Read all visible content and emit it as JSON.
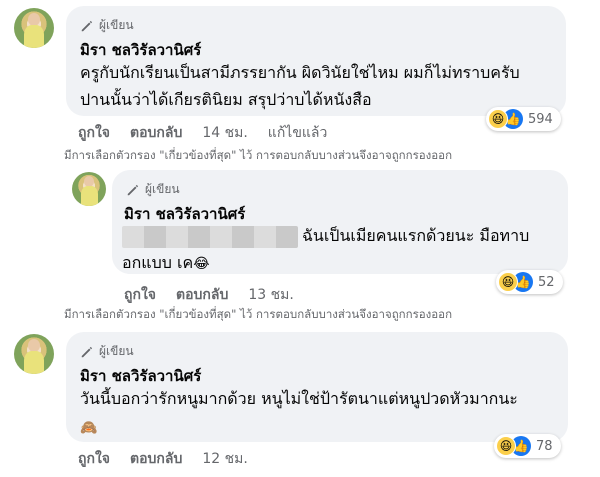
{
  "comments": [
    {
      "badge": "ผู้เขียน",
      "name": "มิรา ชลวิรัลวานิศร์",
      "lines": [
        "ครูกับนักเรียนเป็นสามีภรรยากัน ผิดวินัยใช่ไหม ผมก็ไม่ทราบครับ",
        "ปานนั้นว่าได้เกียรตินิยม สรุปว่าบได้หนังสือ"
      ],
      "reaction_count": "594",
      "like_label": "ถูกใจ",
      "reply_label": "ตอบกลับ",
      "time": "14 ชม.",
      "edited_label": "แก้ไขแล้ว"
    },
    {
      "badge": "ผู้เขียน",
      "name": "มิรา ชลวิรัลวานิศร์",
      "line1_suffix": "ฉันเป็นเมียคนแรกด้วยนะ มือทาบ",
      "line2": "อกแบบ เค",
      "line2_emoji": "😂",
      "reaction_count": "52",
      "like_label": "ถูกใจ",
      "reply_label": "ตอบกลับ",
      "time": "13 ชม."
    },
    {
      "badge": "ผู้เขียน",
      "name": "มิรา ชลวิรัลวานิศร์",
      "line1": "วันนี้บอกว่ารักหนูมากด้วย หนูไม่ใช่ป้ารัตนาแต่หนูปวดหัวมากนะ",
      "line2_emoji": "🙈",
      "reaction_count": "78",
      "like_label": "ถูกใจ",
      "reply_label": "ตอบกลับ",
      "time": "12 ชม."
    }
  ],
  "filter_note": "มีการเลือกตัวกรอง \"เกี่ยวข้องที่สุด\" ไว้ การตอบกลับบางส่วนจึงอาจถูกกรองออก",
  "reaction_icons": {
    "haha": "😆",
    "like": "👍"
  },
  "colors": {
    "bubble": "#f0f2f5",
    "like_blue": "#1877f2",
    "meta_gray": "#65676b"
  }
}
